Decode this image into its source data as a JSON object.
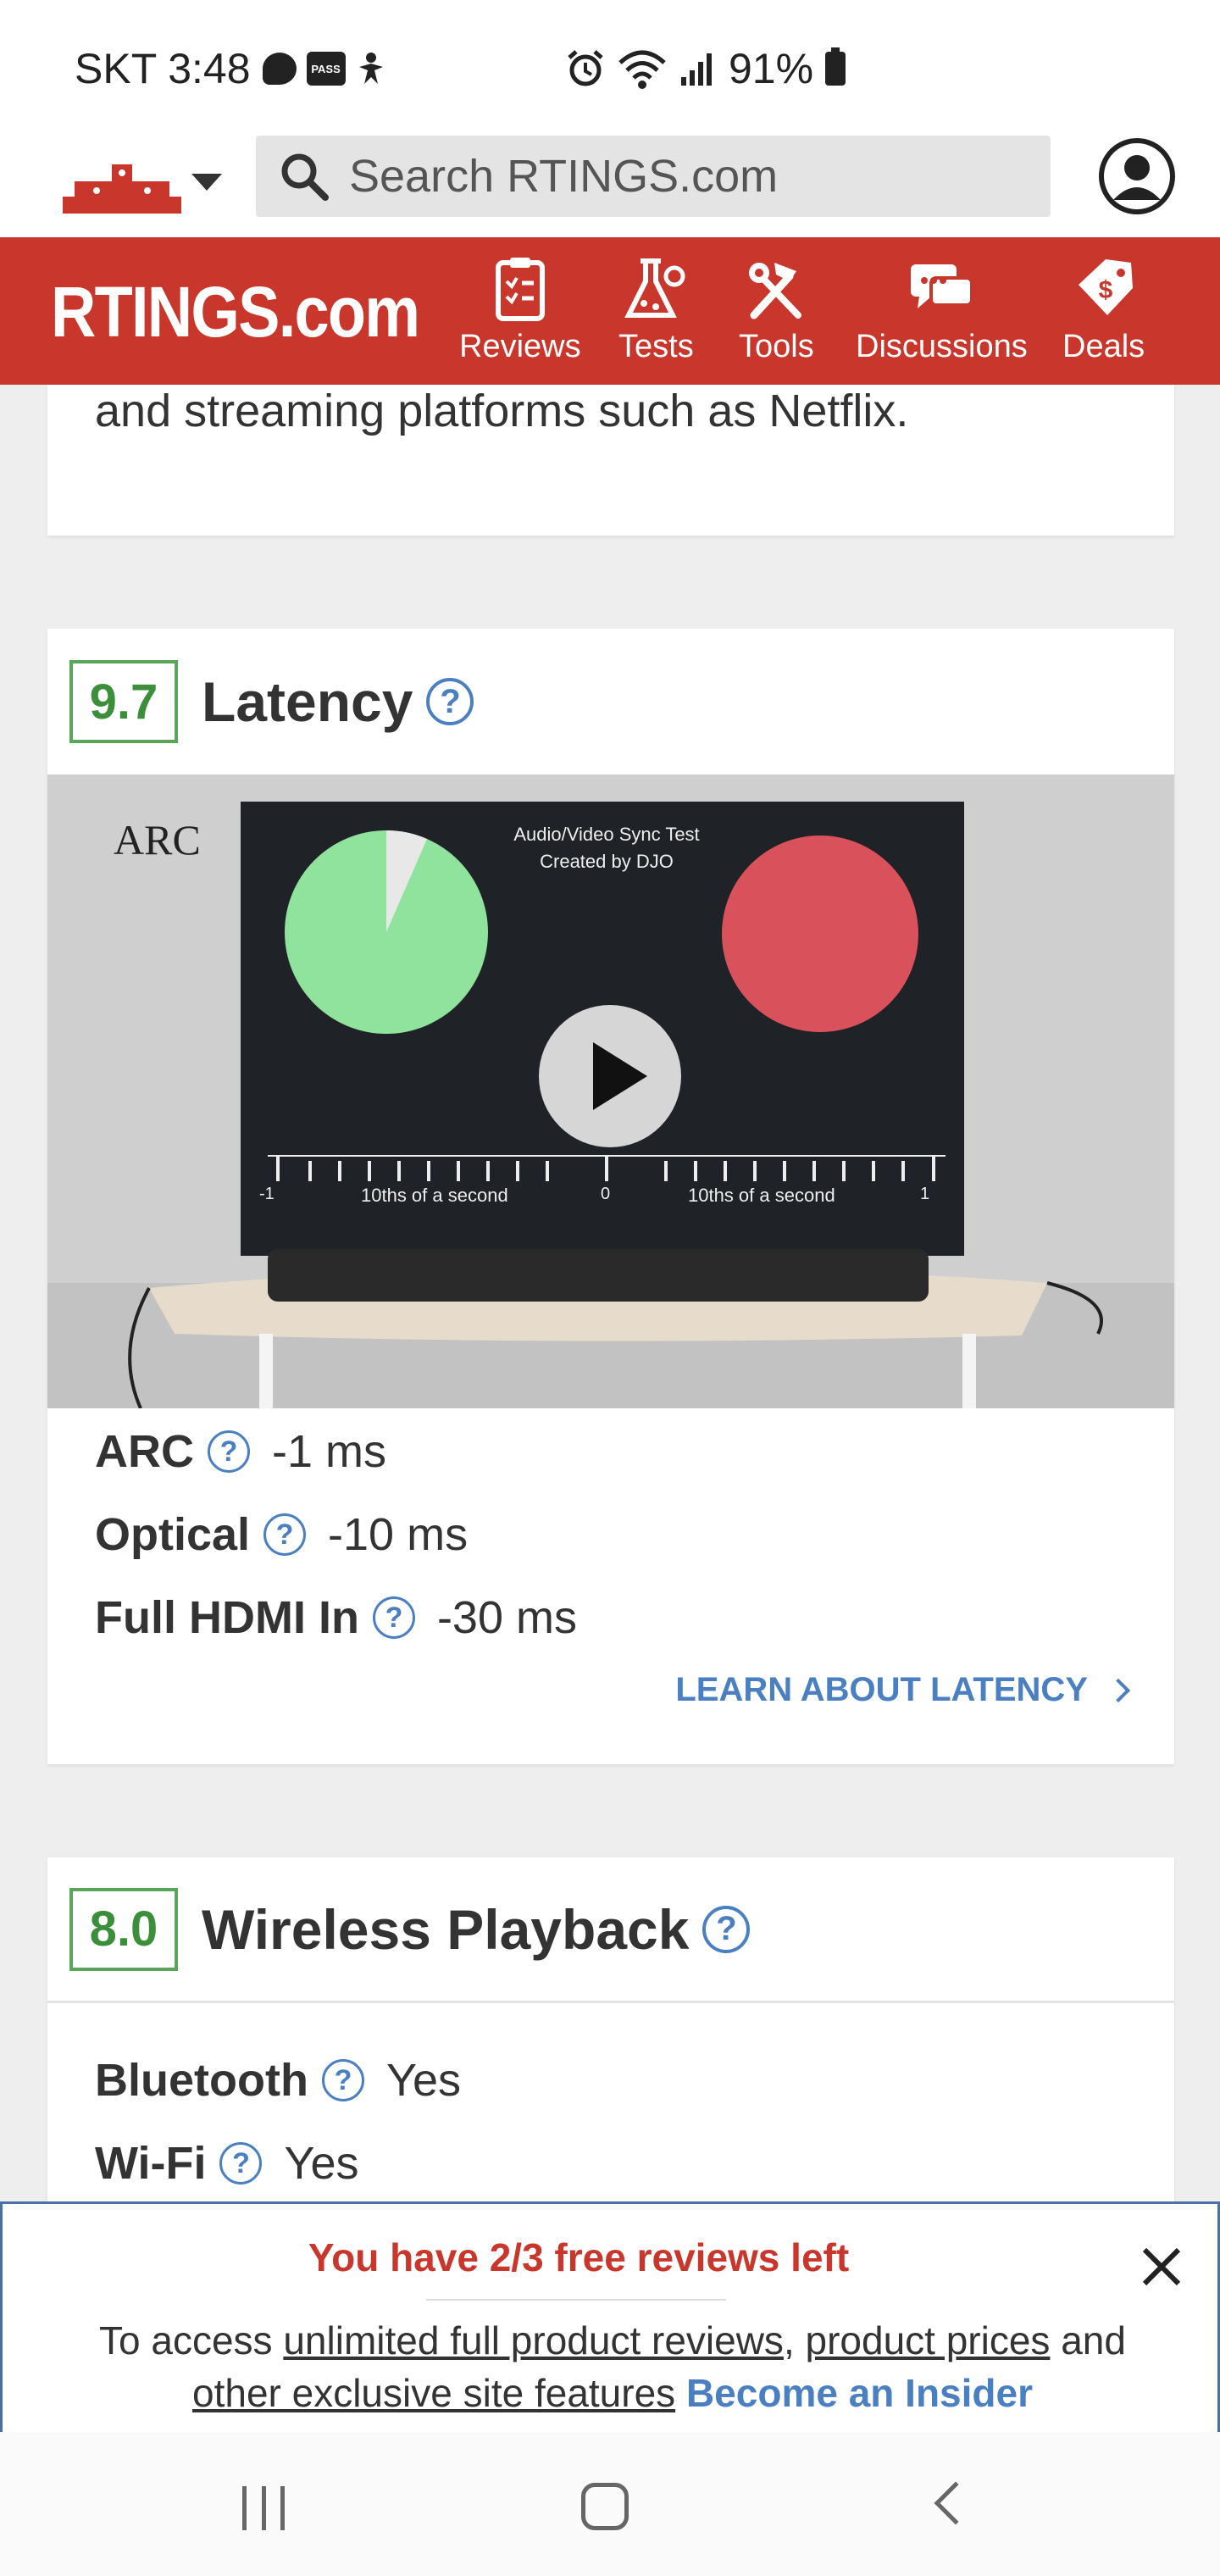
{
  "status_bar": {
    "carrier_time": "SKT 3:48",
    "pass_label": "PASS",
    "battery": "91%"
  },
  "header": {
    "search_placeholder": "Search RTINGS.com"
  },
  "nav": {
    "logo": "RTINGS.com",
    "items": [
      {
        "label": "Reviews",
        "icon": "clipboard-checklist-icon"
      },
      {
        "label": "Tests",
        "icon": "flask-gear-icon"
      },
      {
        "label": "Tools",
        "icon": "hammer-wrench-icon"
      },
      {
        "label": "Discussions",
        "icon": "chat-bubbles-icon"
      },
      {
        "label": "Deals",
        "icon": "price-tag-icon"
      }
    ]
  },
  "top_card": {
    "text": "and streaming platforms such as Netflix."
  },
  "latency": {
    "score": "9.7",
    "title": "Latency",
    "video": {
      "corner_label": "ARC",
      "screen_title_line1": "Audio/Video Sync Test",
      "screen_title_line2": "Created by DJO",
      "scale_left_label": "10ths of a second",
      "scale_right_label": "10ths of a second",
      "scale_min": "-1",
      "scale_mid": "0",
      "scale_max": "1"
    },
    "specs": [
      {
        "label": "ARC",
        "value": "-1 ms"
      },
      {
        "label": "Optical",
        "value": "-10 ms"
      },
      {
        "label": "Full HDMI In",
        "value": "-30 ms"
      }
    ],
    "learn_link": "LEARN ABOUT LATENCY"
  },
  "wireless": {
    "score": "8.0",
    "title": "Wireless Playback",
    "specs": [
      {
        "label": "Bluetooth",
        "value": "Yes"
      },
      {
        "label": "Wi-Fi",
        "value": "Yes"
      }
    ]
  },
  "paywall": {
    "title": "You have 2/3 free reviews left",
    "text_prefix": "To access",
    "link1": "unlimited full product reviews",
    "sep1": ",",
    "link2": "product prices",
    "and": "and",
    "link3": "other exclusive site features",
    "cta": "Become an Insider"
  },
  "help_glyph": "?"
}
